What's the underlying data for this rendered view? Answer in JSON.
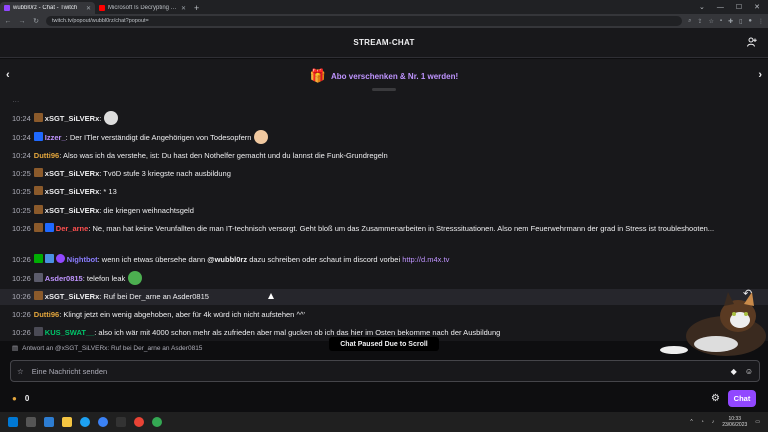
{
  "browser": {
    "tabs": [
      {
        "title": "wubbl0rz - Chat - Twitch",
        "favicon_color": "#9147ff",
        "active": true
      },
      {
        "title": "Microsoft Is Decrypting Your File",
        "favicon_color": "#ff0000",
        "active": false
      }
    ],
    "url": "twitch.tv/popout/wubbl0rz/chat?popout="
  },
  "header": {
    "title": "STREAM-CHAT"
  },
  "promo": {
    "text": "Abo verschenken & Nr. 1 werden!"
  },
  "messages": [
    {
      "time": "10:24",
      "badge": "#8b5a2b",
      "nick": "xSGT_SiLVERx",
      "nick_color": "#efeff1",
      "text": "",
      "emote_color": "#dddddd"
    },
    {
      "time": "10:24",
      "badge": "#1f69ff",
      "nick": "Izzer_",
      "nick_color": "#bf94ff",
      "text": "Der ITler verständigt die Angehörigen von Todesopfern",
      "emote_color": "#f0c8a0"
    },
    {
      "time": "10:24",
      "badge": "",
      "nick": "Dutti96",
      "nick_color": "#e3a63d",
      "text": "Also was ich da verstehe, ist: Du hast den Nothelfer gemacht und du lannst die Funk-Grundregeln",
      "emote_color": ""
    },
    {
      "time": "10:25",
      "badge": "#8b5a2b",
      "nick": "xSGT_SiLVERx",
      "nick_color": "#efeff1",
      "text": "TvöD stufe 3 kriegste nach ausbildung",
      "emote_color": ""
    },
    {
      "time": "10:25",
      "badge": "#8b5a2b",
      "nick": "xSGT_SiLVERx",
      "nick_color": "#efeff1",
      "text": "* 13",
      "emote_color": ""
    },
    {
      "time": "10:25",
      "badge": "#8b5a2b",
      "nick": "xSGT_SiLVERx",
      "nick_color": "#efeff1",
      "text": "die kriegen weihnachtsgeld",
      "emote_color": ""
    },
    {
      "time": "10:26",
      "badge": "#1f69ff",
      "nick": "Der_arne",
      "nick_color": "#ff4f4f",
      "text": "Ne, man hat keine Verunfallten die man IT-technisch versorgt. Geht bloß um das Zusammenarbeiten in Stresssituationen. Also nem Feuerwehrmann der grad in Stress ist troubleshooten...",
      "emote_color": ""
    },
    {
      "time": "10:26",
      "badge": "#00ad03",
      "nick": "Nightbot",
      "nick_color": "#8a7dff",
      "text_before": "wenn ich etwas übersehe dann",
      "mention": "@wubbl0rz",
      "text_after": "dazu schreiben oder schaut im discord vorbei",
      "link": "http://d.m4x.tv"
    },
    {
      "time": "10:26",
      "badge": "#5b5b6b",
      "nick": "Asder0815",
      "nick_color": "#bf94ff",
      "text": "telefon leak",
      "emote_color": "#4caf50"
    },
    {
      "time": "10:26",
      "badge": "#8b5a2b",
      "nick": "xSGT_SiLVERx",
      "nick_color": "#efeff1",
      "text": "Ruf bei Der_arne an Asder0815",
      "emote_color": ""
    },
    {
      "time": "10:26",
      "badge": "",
      "nick": "Dutti96",
      "nick_color": "#e3a63d",
      "text": "Klingt jetzt ein wenig abgehoben, aber für 4k würd ich nicht aufstehen ^^'",
      "emote_color": ""
    },
    {
      "time": "10:26",
      "badge": "#4a4a55",
      "nick": "KUS_SWAT__",
      "nick_color": "#00c46a",
      "text": "also ich wär mit 4000 schon mehr als zufrieden aber mal gucken ob ich das hier im Osten bekomme nach der Ausbildung",
      "emote_color": ""
    }
  ],
  "reply_context": "Antwort an @xSGT_SiLVERx: Ruf bei Der_arne an Asder0815",
  "paused_label": "Chat Paused Due to Scroll",
  "input": {
    "placeholder": "Eine Nachricht senden"
  },
  "points": {
    "count": "0"
  },
  "chat_button": "Chat",
  "clock": {
    "time": "10:33",
    "date": "23/06/2023"
  },
  "colors": {
    "accent": "#9147ff",
    "background": "#18181b"
  }
}
